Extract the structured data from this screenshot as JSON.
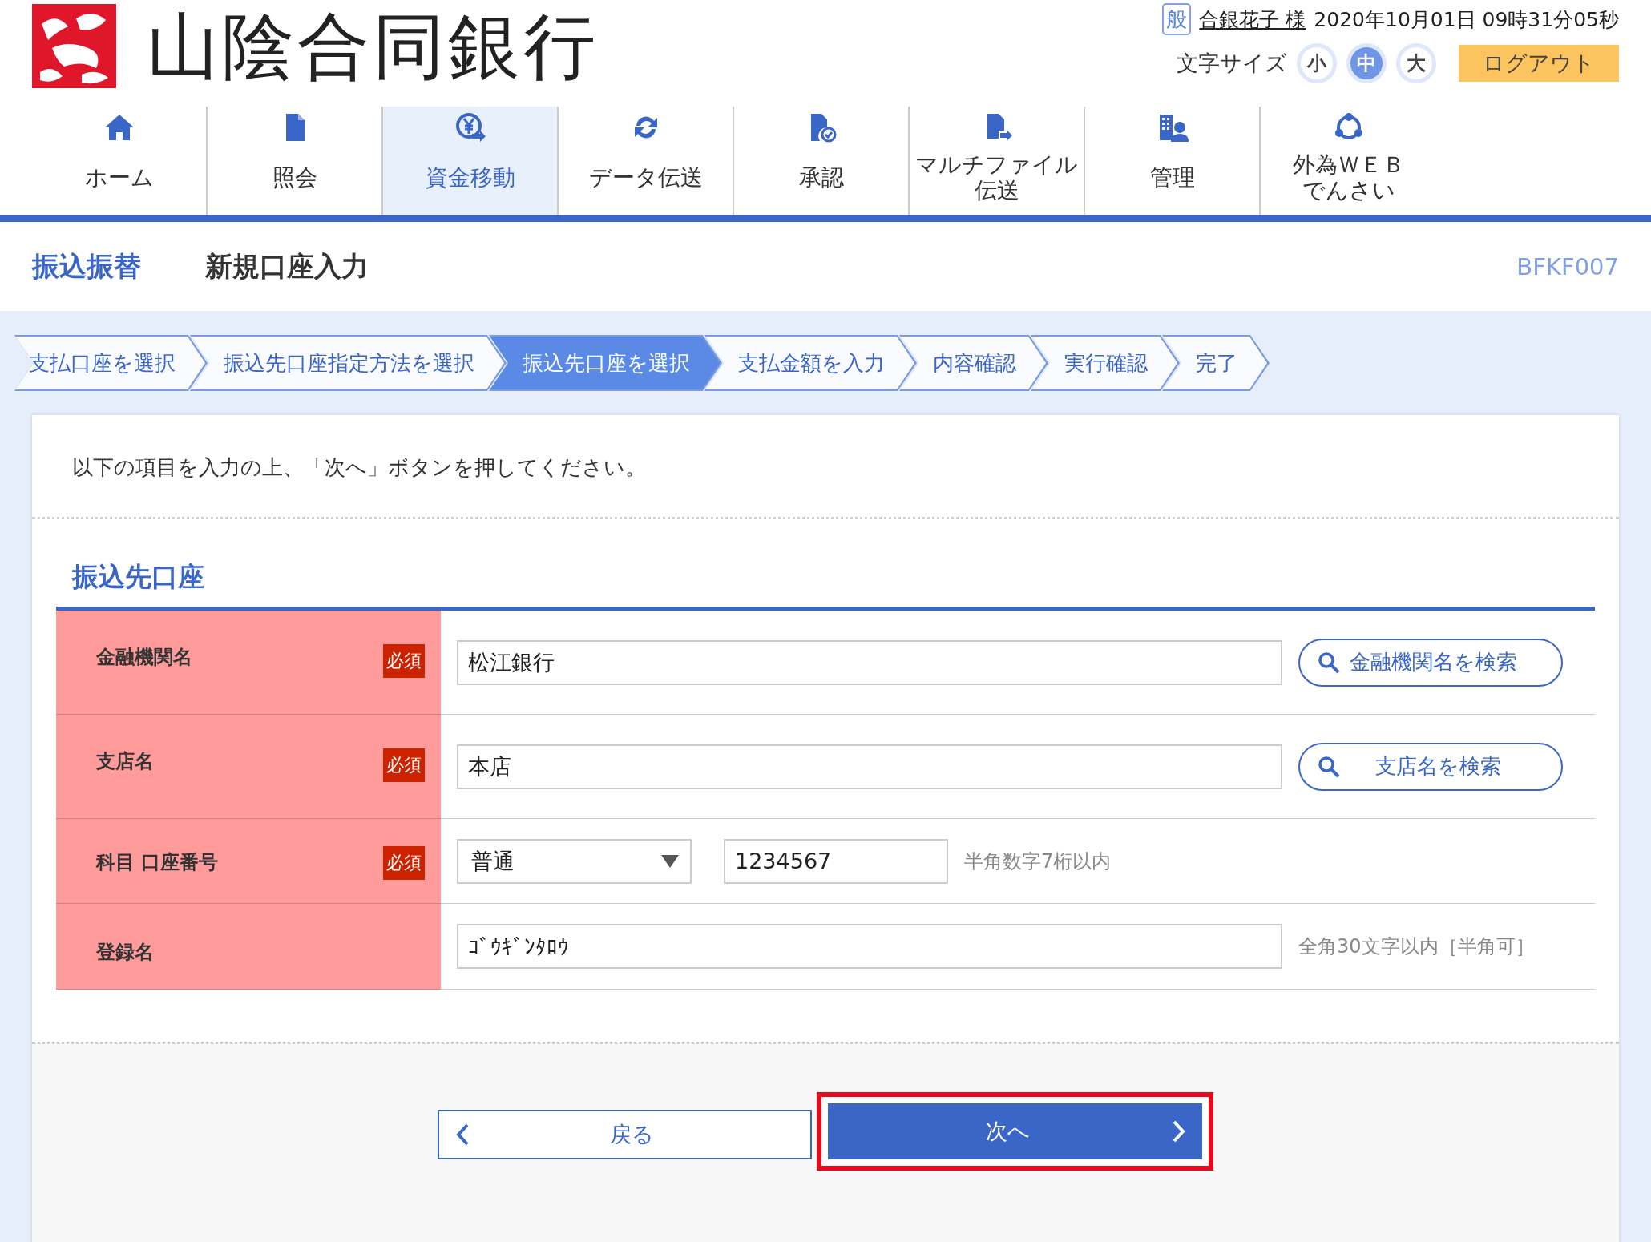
{
  "header": {
    "bank_name": "山陰合同銀行",
    "user_type_badge": "般",
    "user_name": "合銀花子 様",
    "datetime": "2020年10月01日 09時31分05秒",
    "font_size_label": "文字サイズ",
    "font_sizes": [
      {
        "label": "小",
        "selected": false
      },
      {
        "label": "中",
        "selected": true
      },
      {
        "label": "大",
        "selected": false
      }
    ],
    "logout_button": "ログアウト"
  },
  "nav": {
    "items": [
      {
        "label": "ホーム",
        "selected": false
      },
      {
        "label": "照会",
        "selected": false
      },
      {
        "label": "資金移動",
        "selected": true
      },
      {
        "label": "データ伝送",
        "selected": false
      },
      {
        "label": "承認",
        "selected": false
      },
      {
        "label_lines": [
          "マルチファイル",
          "伝送"
        ],
        "selected": false
      },
      {
        "label": "管理",
        "selected": false
      },
      {
        "label_lines": [
          "外為ＷＥＢ",
          "でんさい"
        ],
        "selected": false
      }
    ]
  },
  "page_title": {
    "category": "振込振替",
    "title": "新規口座入力",
    "screen_id": "BFKF007"
  },
  "steps": [
    {
      "label": "支払口座を選択",
      "selected": false
    },
    {
      "label": "振込先口座指定方法を選択",
      "selected": false
    },
    {
      "label": "振込先口座を選択",
      "selected": true
    },
    {
      "label": "支払金額を入力",
      "selected": false
    },
    {
      "label": "内容確認",
      "selected": false
    },
    {
      "label": "実行確認",
      "selected": false
    },
    {
      "label": "完了",
      "selected": false
    }
  ],
  "instruction": "以下の項目を入力の上、「次へ」ボタンを押してください。",
  "section_title": "振込先口座",
  "form_rows": [
    {
      "label": "金融機関名",
      "required": true,
      "badge": "必須",
      "fields": [
        {
          "kind": "text",
          "value": "松江銀行"
        }
      ],
      "search_button": "金融機関名を検索"
    },
    {
      "label": "支店名",
      "required": true,
      "badge": "必須",
      "fields": [
        {
          "kind": "text",
          "value": "本店"
        }
      ],
      "search_button": "支店名を検索"
    },
    {
      "label": "科目 口座番号",
      "required": true,
      "badge": "必須",
      "fields": [
        {
          "kind": "select",
          "value": "普通"
        },
        {
          "kind": "number",
          "value": "1234567"
        }
      ],
      "hint": "半角数字7桁以内"
    },
    {
      "label": "登録名",
      "required": false,
      "fields": [
        {
          "kind": "text",
          "value": "ｺﾞｳｷﾞﾝﾀﾛｳ"
        }
      ],
      "hint": "全角30文字以内［半角可］"
    }
  ],
  "buttons": {
    "back": "戻る",
    "next": "次へ",
    "next_highlighted": true
  }
}
